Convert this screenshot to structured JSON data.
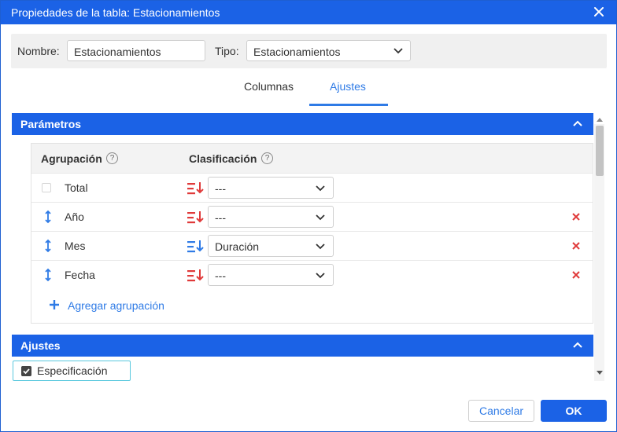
{
  "window": {
    "title": "Propiedades de la tabla: Estacionamientos"
  },
  "form": {
    "name_label": "Nombre:",
    "name_value": "Estacionamientos",
    "type_label": "Tipo:",
    "type_value": "Estacionamientos"
  },
  "tabs": [
    {
      "label": "Columnas",
      "active": false
    },
    {
      "label": "Ajustes",
      "active": true
    }
  ],
  "parameters_section": {
    "title": "Parámetros",
    "grouping_header": "Agrupación",
    "sorting_header": "Clasificación",
    "help_glyph": "?",
    "rows": [
      {
        "name": "Total",
        "sort": "---",
        "sort_icon": "sort-descending-red-icon",
        "removable": false
      },
      {
        "name": "Año",
        "sort": "---",
        "sort_icon": "sort-descending-red-icon",
        "removable": true
      },
      {
        "name": "Mes",
        "sort": "Duración",
        "sort_icon": "sort-ascending-blue-icon",
        "removable": true
      },
      {
        "name": "Fecha",
        "sort": "---",
        "sort_icon": "sort-descending-red-icon",
        "removable": true
      }
    ],
    "add_grouping_label": "Agregar agrupación"
  },
  "settings_section": {
    "title": "Ajustes",
    "specification_label": "Especificación",
    "specification_checked": true
  },
  "buttons": {
    "cancel": "Cancelar",
    "ok": "OK"
  },
  "colors": {
    "accent": "#1b62e6",
    "link": "#2f7be6",
    "delete": "#e03a3a",
    "sort_desc": "#e03a3a",
    "sort_asc": "#2f7be6"
  }
}
